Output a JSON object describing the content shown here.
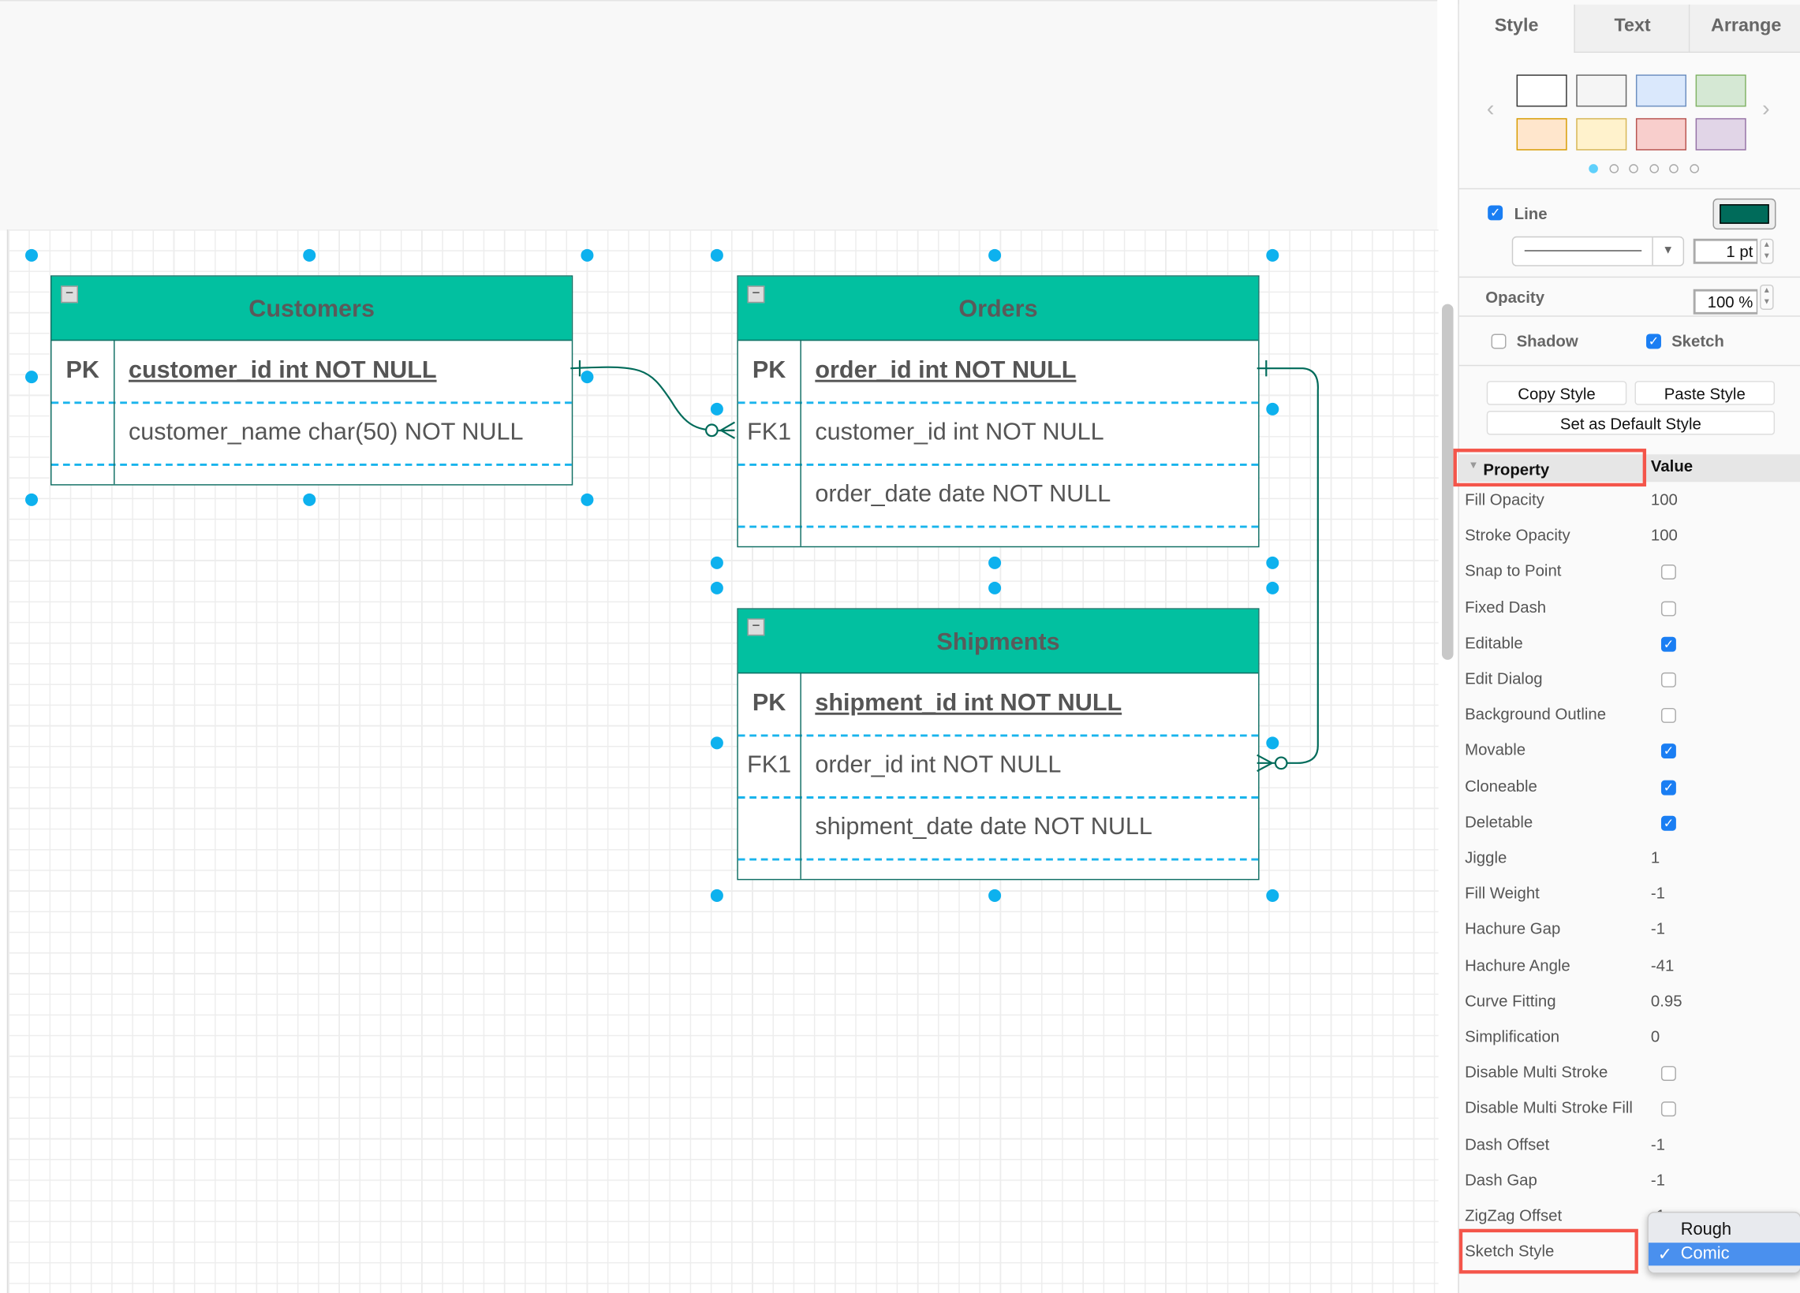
{
  "tables": [
    {
      "name": "Customers",
      "rows": [
        {
          "key": "PK",
          "value": "customer_id int NOT NULL",
          "pk": true
        },
        {
          "key": "",
          "value": "customer_name char(50) NOT NULL",
          "pk": false
        }
      ]
    },
    {
      "name": "Orders",
      "rows": [
        {
          "key": "PK",
          "value": "order_id int NOT NULL",
          "pk": true
        },
        {
          "key": "FK1",
          "value": "customer_id int NOT NULL",
          "pk": false
        },
        {
          "key": "",
          "value": "order_date date NOT NULL",
          "pk": false
        }
      ]
    },
    {
      "name": "Shipments",
      "rows": [
        {
          "key": "PK",
          "value": "shipment_id int NOT NULL",
          "pk": true
        },
        {
          "key": "FK1",
          "value": "order_id int NOT NULL",
          "pk": false
        },
        {
          "key": "",
          "value": "shipment_date date NOT NULL",
          "pk": false
        }
      ]
    }
  ],
  "colors": {
    "header_fill": "#02c0a0",
    "stroke": "#0f6e63",
    "selection": "#0db1ee",
    "line_color": "#006b5a"
  },
  "panel": {
    "tabs": [
      "Style",
      "Text",
      "Arrange"
    ],
    "swatches": [
      {
        "fill": "#ffffff",
        "stroke": "#333333"
      },
      {
        "fill": "#f5f5f5",
        "stroke": "#666666"
      },
      {
        "fill": "#dae8fc",
        "stroke": "#6c8ebf"
      },
      {
        "fill": "#d5e8d4",
        "stroke": "#82b366"
      },
      {
        "fill": "#ffe6cc",
        "stroke": "#d79b00"
      },
      {
        "fill": "#fff2cc",
        "stroke": "#d6b656"
      },
      {
        "fill": "#f8cecc",
        "stroke": "#b85450"
      },
      {
        "fill": "#e1d5e7",
        "stroke": "#9673a6"
      }
    ],
    "swatch_page": 1,
    "swatch_pages": 6,
    "line_label": "Line",
    "line_checked": true,
    "line_width": "1 pt",
    "opacity_label": "Opacity",
    "opacity_value": "100 %",
    "shadow_label": "Shadow",
    "shadow_checked": false,
    "sketch_label": "Sketch",
    "sketch_checked": true,
    "copy_style": "Copy Style",
    "paste_style": "Paste Style",
    "default_style": "Set as Default Style",
    "prop_header": "Property",
    "value_header": "Value",
    "properties": [
      {
        "name": "Fill Opacity",
        "value": "100"
      },
      {
        "name": "Stroke Opacity",
        "value": "100"
      },
      {
        "name": "Snap to Point",
        "checkbox": false
      },
      {
        "name": "Fixed Dash",
        "checkbox": false
      },
      {
        "name": "Editable",
        "checkbox": true
      },
      {
        "name": "Edit Dialog",
        "checkbox": false
      },
      {
        "name": "Background Outline",
        "checkbox": false
      },
      {
        "name": "Movable",
        "checkbox": true
      },
      {
        "name": "Cloneable",
        "checkbox": true
      },
      {
        "name": "Deletable",
        "checkbox": true
      },
      {
        "name": "Jiggle",
        "value": "1"
      },
      {
        "name": "Fill Weight",
        "value": "-1"
      },
      {
        "name": "Hachure Gap",
        "value": "-1"
      },
      {
        "name": "Hachure Angle",
        "value": "-41"
      },
      {
        "name": "Curve Fitting",
        "value": "0.95"
      },
      {
        "name": "Simplification",
        "value": "0"
      },
      {
        "name": "Disable Multi Stroke",
        "checkbox": false
      },
      {
        "name": "Disable Multi Stroke Fill",
        "checkbox": false
      },
      {
        "name": "Dash Offset",
        "value": "-1"
      },
      {
        "name": "Dash Gap",
        "value": "-1"
      },
      {
        "name": "ZigZag Offset",
        "value": "-1"
      },
      {
        "name": "Sketch Style",
        "value": ""
      }
    ],
    "sketch_style_options": [
      "Rough",
      "Comic"
    ],
    "sketch_style_selected": "Comic"
  }
}
